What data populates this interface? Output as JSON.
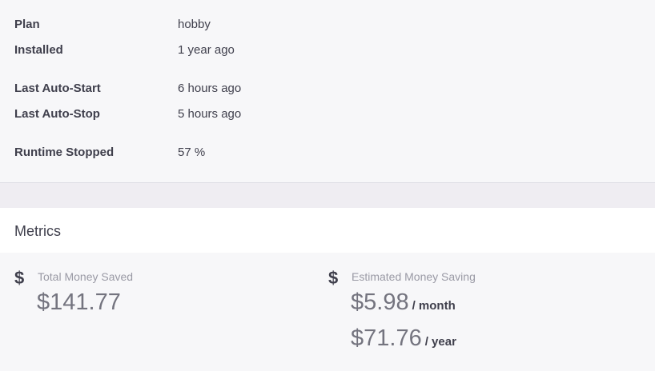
{
  "details": {
    "plan": {
      "label": "Plan",
      "value": "hobby"
    },
    "installed": {
      "label": "Installed",
      "value": "1 year ago"
    },
    "last_auto_start": {
      "label": "Last Auto-Start",
      "value": "6 hours ago"
    },
    "last_auto_stop": {
      "label": "Last Auto-Stop",
      "value": "5 hours ago"
    },
    "runtime_stopped": {
      "label": "Runtime Stopped",
      "value": "57 %"
    }
  },
  "metrics": {
    "title": "Metrics",
    "total_saved": {
      "icon": "dollar-icon",
      "label": "Total Money Saved",
      "value": "$141.77"
    },
    "estimated_saving": {
      "icon": "dollar-icon",
      "label": "Estimated Money Saving",
      "monthly_value": "$5.98",
      "monthly_unit": "/ month",
      "yearly_value": "$71.76",
      "yearly_unit": "/ year"
    }
  }
}
